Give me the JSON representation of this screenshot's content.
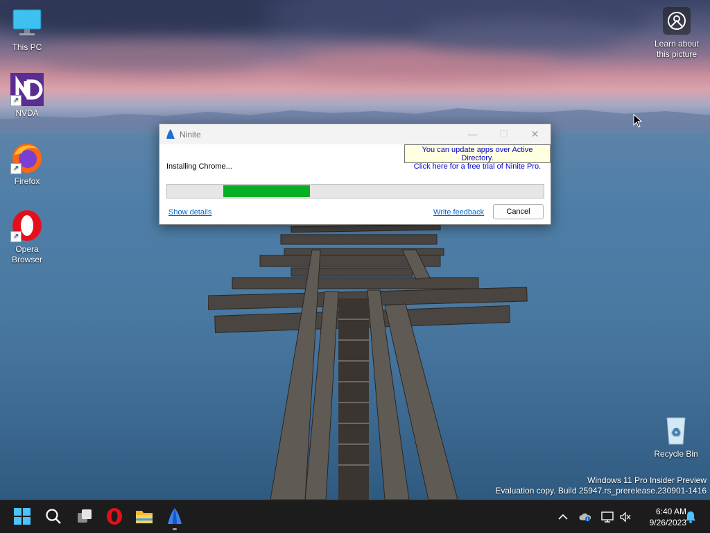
{
  "desktop": {
    "icons": [
      {
        "label": "This PC",
        "icon": "monitor-icon"
      },
      {
        "label": "NVDA",
        "icon": "nvda-icon"
      },
      {
        "label": "Firefox",
        "icon": "firefox-icon"
      },
      {
        "label": "Opera Browser",
        "icon": "opera-icon"
      }
    ],
    "learn_about": "Learn about this picture",
    "recycle_bin": "Recycle Bin",
    "watermark_line1": "Windows 11 Pro Insider Preview",
    "watermark_line2": "Evaluation copy. Build 25947.rs_prerelease.230901-1416"
  },
  "ninite": {
    "title": "Ninite",
    "ad_line1": "You can update apps over Active Directory.",
    "ad_line2": "Click here for a free trial of Ninite Pro.",
    "status": "Installing Chrome...",
    "progress_start": 0.15,
    "progress_end": 0.38,
    "show_details": "Show details",
    "write_feedback": "Write feedback",
    "cancel": "Cancel",
    "minimize_glyph": "—",
    "maximize_glyph": "☐",
    "close_glyph": "✕",
    "accent_green": "#06b025"
  },
  "taskbar": {
    "apps": [
      "start-icon",
      "search-icon",
      "task-view-icon",
      "opera-icon",
      "file-explorer-icon",
      "ninite-icon"
    ],
    "tray_icons": [
      "chevron-up-icon",
      "onedrive-icon",
      "network-icon",
      "volume-muted-icon",
      "notification-bell-icon"
    ],
    "time": "6:40 AM",
    "date": "9/26/2023"
  }
}
